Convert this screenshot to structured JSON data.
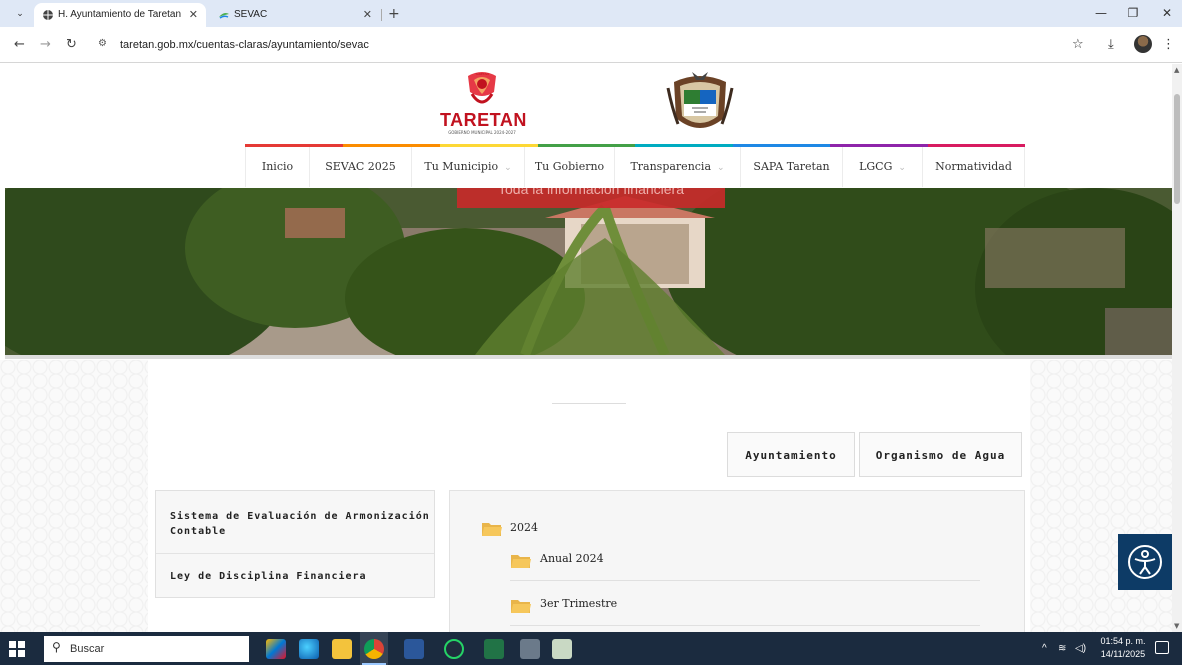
{
  "browser": {
    "tabs": [
      {
        "title": "H. Ayuntamiento de Taretan",
        "active": true
      },
      {
        "title": "SEVAC",
        "active": false
      }
    ],
    "url": "taretan.gob.mx/cuentas-claras/ayuntamiento/sevac"
  },
  "header": {
    "logo_text": "TARETAN",
    "logo_subtext": "GOBIERNO MUNICIPAL 2024-2027",
    "menu": [
      {
        "label": "Inicio",
        "dropdown": false
      },
      {
        "label": "SEVAC 2025",
        "dropdown": false
      },
      {
        "label": "Tu Municipio",
        "dropdown": true
      },
      {
        "label": "Tu Gobierno",
        "dropdown": false
      },
      {
        "label": "Transparencia",
        "dropdown": true
      },
      {
        "label": "SAPA Taretan",
        "dropdown": false
      },
      {
        "label": "LGCG",
        "dropdown": true
      },
      {
        "label": "Normatividad",
        "dropdown": false
      }
    ],
    "menu_strip_colors": [
      "#e53935",
      "#fb8c00",
      "#fdd835",
      "#43a047",
      "#00acc1",
      "#1e88e5",
      "#8e24aa",
      "#d81b60"
    ]
  },
  "hero": {
    "banner_text": "Toda la información financiera"
  },
  "tabs": {
    "ayuntamiento": "Ayuntamiento",
    "organismo": "Organismo de Agua"
  },
  "sidebar": {
    "items": [
      "Sistema de Evaluación de Armonización Contable",
      "Ley de Disciplina Financiera"
    ]
  },
  "folders": {
    "root": "2024",
    "children": [
      "Anual 2024",
      "3er Trimestre"
    ]
  },
  "taskbar": {
    "search_placeholder": "Buscar",
    "time": "01:54 p. m.",
    "date": "14/11/2025"
  },
  "colors": {
    "brand_red": "#c1121f",
    "taskbar": "#1b2b3f",
    "a11y_button": "#0d3b66",
    "folder": "#f6c75b"
  }
}
